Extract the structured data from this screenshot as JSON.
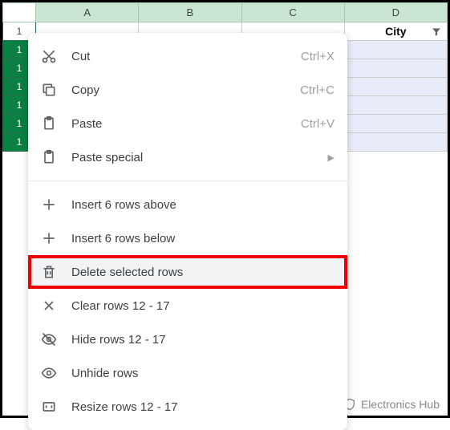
{
  "columns": {
    "A": "A",
    "B": "B",
    "C": "C",
    "D": "D"
  },
  "header_row_num": "1",
  "city_header": "City",
  "selected_rows": [
    "1",
    "1",
    "1",
    "1",
    "1",
    "1"
  ],
  "menu": {
    "cut": {
      "label": "Cut",
      "shortcut": "Ctrl+X"
    },
    "copy": {
      "label": "Copy",
      "shortcut": "Ctrl+C"
    },
    "paste": {
      "label": "Paste",
      "shortcut": "Ctrl+V"
    },
    "paste_special": {
      "label": "Paste special"
    },
    "insert_above": {
      "label": "Insert 6 rows above"
    },
    "insert_below": {
      "label": "Insert 6 rows below"
    },
    "delete_rows": {
      "label": "Delete selected rows"
    },
    "clear_rows": {
      "label": "Clear rows 12 - 17"
    },
    "hide_rows": {
      "label": "Hide rows 12 - 17"
    },
    "unhide_rows": {
      "label": "Unhide rows"
    },
    "resize_rows": {
      "label": "Resize rows 12 - 17"
    }
  },
  "watermark": "Electronics Hub"
}
